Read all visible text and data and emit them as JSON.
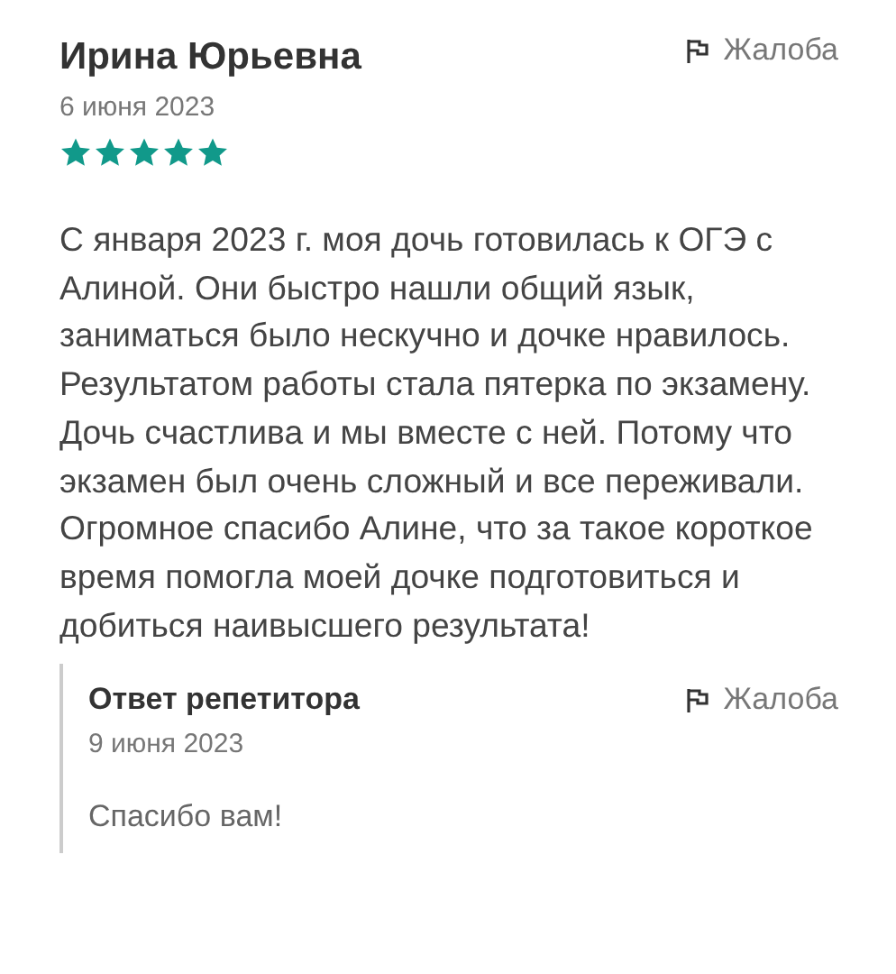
{
  "review": {
    "author": "Ирина Юрьевна",
    "date": "6 июня 2023",
    "stars": 5,
    "complaint": "Жалоба",
    "text": "С января 2023 г. моя дочь готовилась к ОГЭ с Алиной. Они быстро нашли общий язык, заниматься было нескучно и дочке нравилось. Результатом работы стала пятерка по экзамену. Дочь счастлива и мы вместе с ней. Потому что экзамен был очень сложный и все переживали. Огромное спасибо Алине, что за такое короткое время помогла моей дочке подготовиться и добиться наивысшего результата!"
  },
  "reply": {
    "title": "Ответ репетитора",
    "date": "9 июня 2023",
    "complaint": "Жалоба",
    "text": "Спасибо вам!"
  }
}
